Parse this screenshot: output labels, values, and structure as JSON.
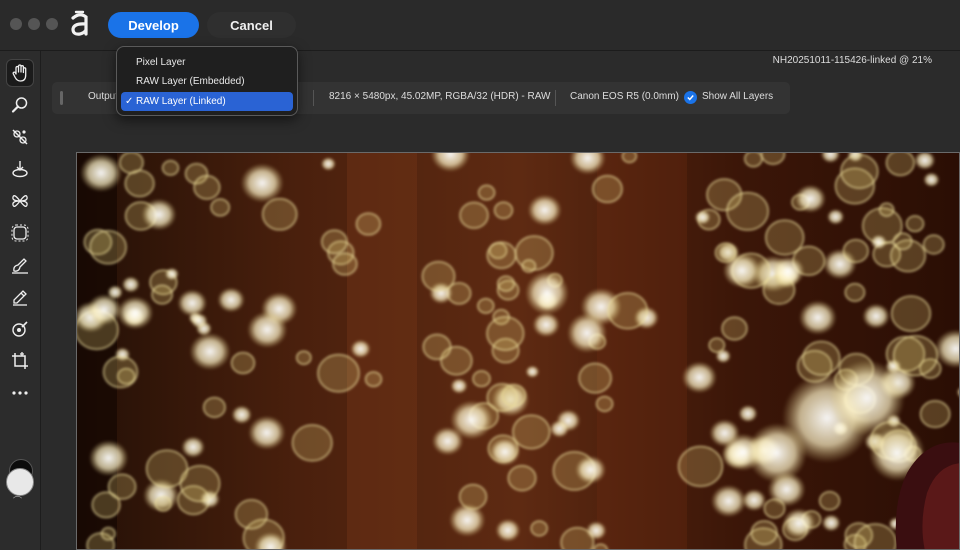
{
  "window": {
    "traffic_lights": [
      "close",
      "minimize",
      "zoom"
    ],
    "logo_icon": "affinity-logo-icon"
  },
  "header": {
    "develop_label": "Develop",
    "cancel_label": "Cancel",
    "document_title": "NH20251011-115426-linked @ 21%"
  },
  "toolbar": {
    "tools": [
      {
        "name": "view-tool",
        "icon": "hand-icon",
        "active": true
      },
      {
        "name": "zoom-tool",
        "icon": "magnifier-icon"
      },
      {
        "name": "red-eye-tool",
        "icon": "red-eye-icon"
      },
      {
        "name": "blemish-tool",
        "icon": "blemish-icon"
      },
      {
        "name": "overlay-paint-tool",
        "icon": "overlay-paint-icon"
      },
      {
        "name": "overlay-selection-tool",
        "icon": "overlay-selection-icon"
      },
      {
        "name": "overlay-gradient-tool",
        "icon": "overlay-gradient-icon"
      },
      {
        "name": "overlay-erase-tool",
        "icon": "overlay-erase-icon"
      },
      {
        "name": "white-balance-tool",
        "icon": "white-balance-icon"
      },
      {
        "name": "crop-tool",
        "icon": "crop-icon"
      },
      {
        "name": "more-tools",
        "icon": "more-icon"
      }
    ],
    "foreground_color": "#e8e8e8",
    "background_color": "#0c0c0c"
  },
  "context_bar": {
    "output_label": "Output",
    "image_info": "8216 × 5480px, 45.02MP, RGBA/32 (HDR) - RAW",
    "camera_info": "Canon EOS R5 (0.0mm)",
    "show_all_layers_label": "Show All Layers",
    "show_all_layers_checked": true
  },
  "output_menu": {
    "items": [
      {
        "label": "Pixel Layer",
        "selected": false
      },
      {
        "label": "RAW Layer (Embedded)",
        "selected": false
      },
      {
        "label": "RAW Layer (Linked)",
        "selected": true
      }
    ],
    "checkmark": "✓"
  },
  "colors": {
    "accent": "#1a73e8",
    "menu_selection": "#2a63d4",
    "chrome": "#2b2b2b"
  }
}
